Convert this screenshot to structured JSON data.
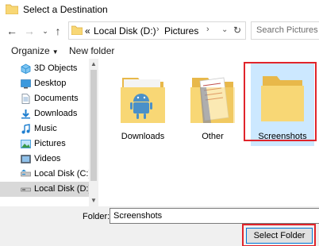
{
  "window": {
    "title": "Select a Destination",
    "icon": "folder-icon"
  },
  "nav": {
    "back_icon": "back-arrow-icon",
    "forward_icon": "forward-arrow-icon",
    "recent_icon": "chevron-down-icon",
    "up_icon": "up-arrow-icon",
    "address": {
      "overflow": "«",
      "crumbs": [
        "Local Disk (D:)",
        "Pictures"
      ],
      "separator": "›"
    },
    "refresh_icon": "refresh-icon",
    "search_placeholder": "Search Pictures"
  },
  "toolbar": {
    "organize": "Organize",
    "new_folder": "New folder"
  },
  "sidebar": {
    "items": [
      {
        "label": "3D Objects",
        "icon": "3d-objects-icon"
      },
      {
        "label": "Desktop",
        "icon": "desktop-icon"
      },
      {
        "label": "Documents",
        "icon": "documents-icon"
      },
      {
        "label": "Downloads",
        "icon": "downloads-icon"
      },
      {
        "label": "Music",
        "icon": "music-icon"
      },
      {
        "label": "Pictures",
        "icon": "pictures-icon"
      },
      {
        "label": "Videos",
        "icon": "videos-icon"
      },
      {
        "label": "Local Disk (C:)",
        "icon": "drive-icon"
      },
      {
        "label": "Local Disk (D:)",
        "icon": "drive-icon",
        "selected": true
      }
    ]
  },
  "folders": [
    {
      "label": "Downloads",
      "icon": "android-folder-icon"
    },
    {
      "label": "Other",
      "icon": "documents-folder-icon"
    },
    {
      "label": "Screenshots",
      "icon": "folder-icon",
      "selected": true
    }
  ],
  "footer": {
    "folder_label": "Folder:",
    "folder_value": "Screenshots",
    "select_button": "Select Folder"
  },
  "colors": {
    "selection": "#cce8ff",
    "highlight": "#e0242b",
    "folder_yellow": "#f8d775",
    "accent": "#0078d7"
  }
}
